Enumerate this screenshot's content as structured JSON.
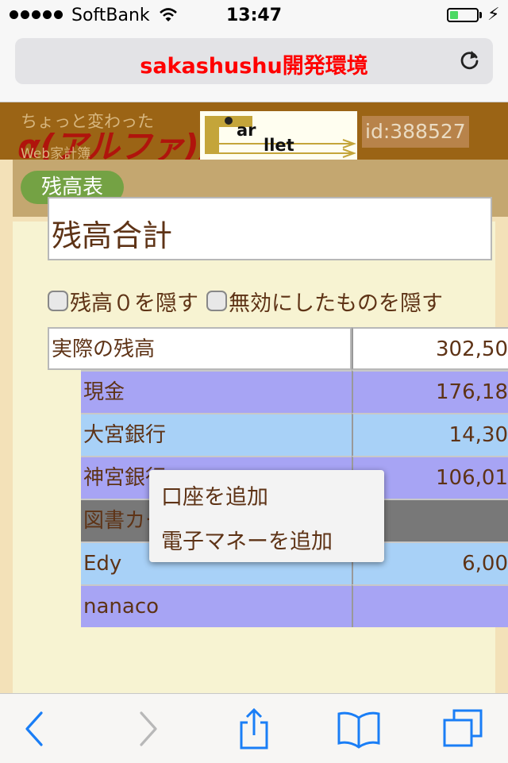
{
  "status_bar": {
    "carrier": "SoftBank",
    "time": "13:47",
    "battery_level": 0.3
  },
  "address_bar": {
    "page_title": "sakashushu開発環境"
  },
  "header": {
    "logo_tagline_1": "ちょっと変わった",
    "logo_main": "α(アルファ)版",
    "logo_tagline_2": "Web家計簿",
    "banner_text_1": "ar",
    "banner_text_2": "llet",
    "user_id": "id:388527"
  },
  "nav": {
    "balance_tab": "残高表"
  },
  "main": {
    "title": "残高合計",
    "hide_zero_label": "残高０を隠す",
    "hide_disabled_label": "無効にしたものを隠す",
    "rows": [
      {
        "name": "実際の残高",
        "amount": "302,50",
        "bg": "#ffffff",
        "indent": false
      },
      {
        "name": "現金",
        "amount": "176,18",
        "bg": "#a7a4f4",
        "indent": true
      },
      {
        "name": "大宮銀行",
        "amount": "14,30",
        "bg": "#a8d1f7",
        "indent": true
      },
      {
        "name": "神宮銀行",
        "amount": "106,01",
        "bg": "#a7a4f4",
        "indent": true
      },
      {
        "name": "図書カード",
        "amount": "",
        "bg": "#787878",
        "indent": true
      },
      {
        "name": "Edy",
        "amount": "6,00",
        "bg": "#a8d1f7",
        "indent": true
      },
      {
        "name": "nanaco",
        "amount": "",
        "bg": "#a7a4f4",
        "indent": true
      }
    ]
  },
  "popup_menu": {
    "add_account": "口座を追加",
    "add_emoney": "電子マネーを追加"
  },
  "colors": {
    "accent_blue": "#1a7ef6",
    "title_red": "#ff0000",
    "header_brown": "#9b6415",
    "nav_green": "#74a244",
    "text_brown": "#5e3316"
  },
  "icons": {
    "back": "chevron-left-icon",
    "forward": "chevron-right-icon",
    "share": "share-icon",
    "bookmarks": "book-icon",
    "tabs": "tabs-icon",
    "reload": "reload-icon",
    "wifi": "wifi-icon"
  }
}
